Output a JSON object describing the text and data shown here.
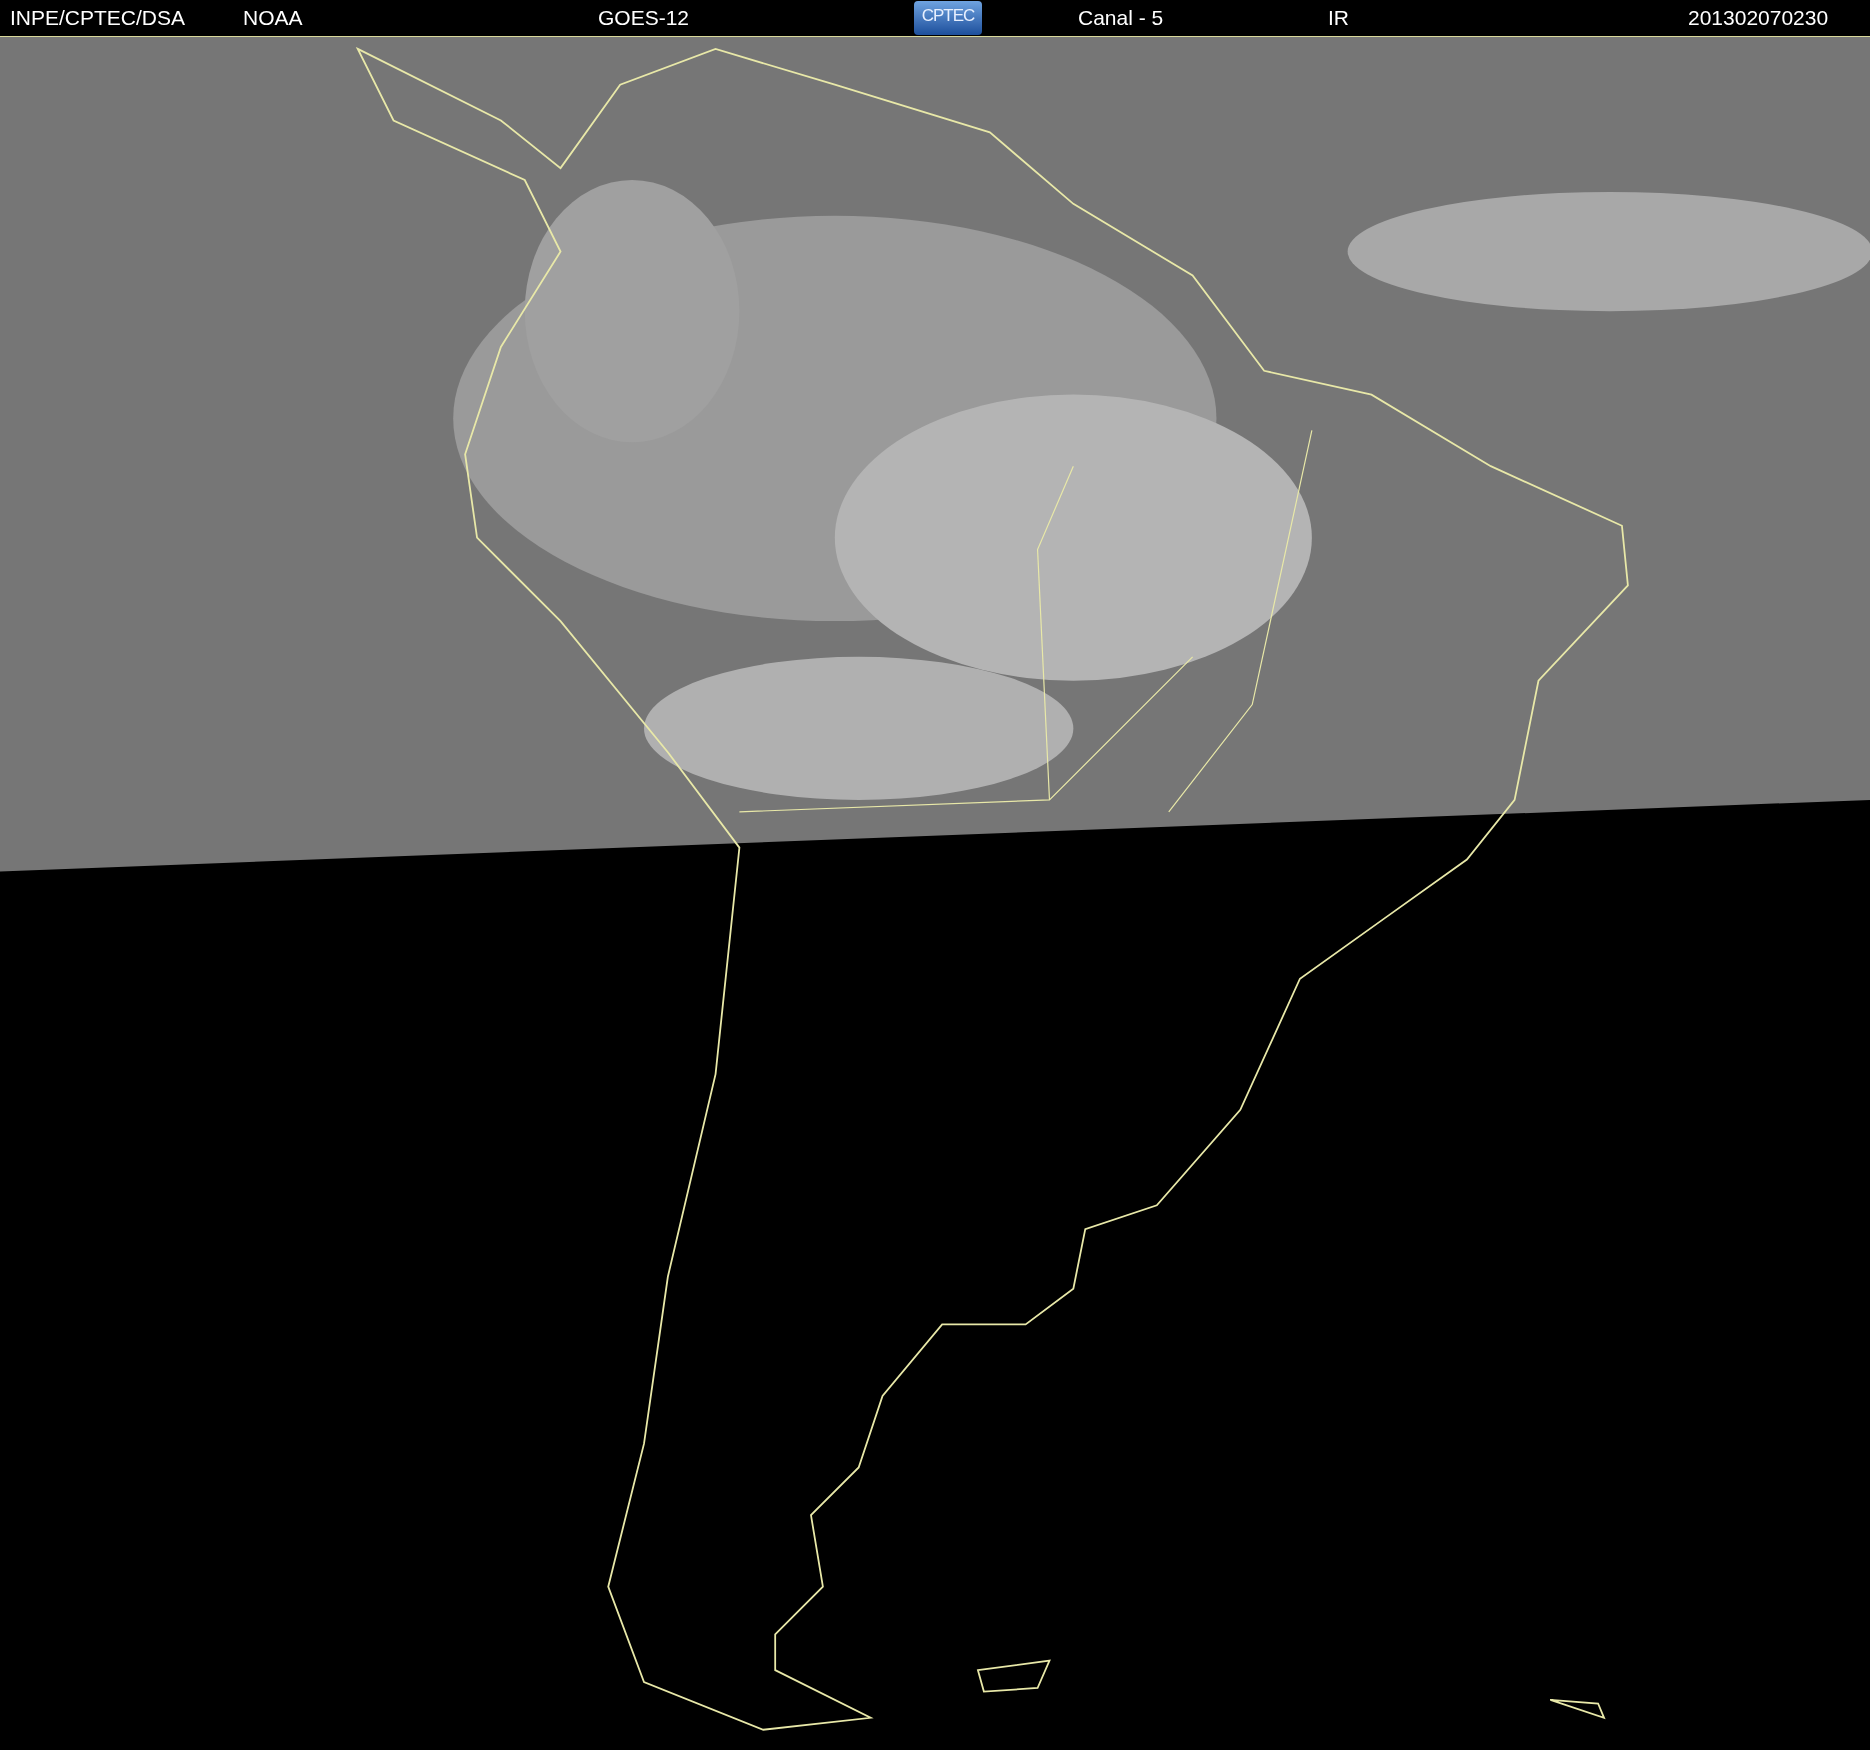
{
  "header": {
    "items": [
      {
        "kind": "text",
        "text": "INPE/CPTEC/DSA"
      },
      {
        "kind": "text",
        "text": "NOAA"
      },
      {
        "kind": "text",
        "text": "GOES-12"
      },
      {
        "kind": "logo",
        "text": "CPTEC"
      },
      {
        "kind": "text",
        "text": "Canal - 5"
      },
      {
        "kind": "text",
        "text": "IR"
      },
      {
        "kind": "text",
        "text": "201302070230"
      }
    ]
  }
}
